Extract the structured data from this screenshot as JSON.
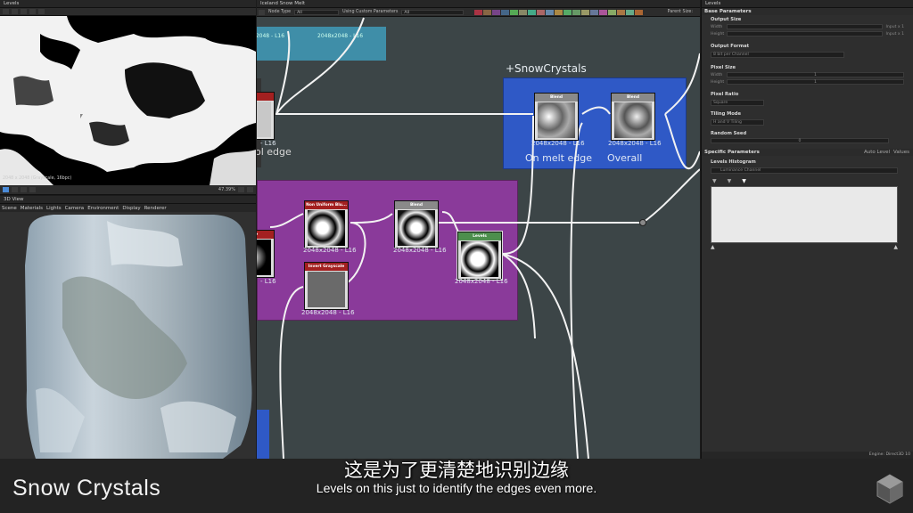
{
  "colors": {
    "accent": "#4b8bd8",
    "blue_frame": "#2d56c0",
    "purple_frame": "#8a3a9a",
    "teal_frame": "#4a8fa8",
    "red_header": "#a32020",
    "green_header": "#4d8f4d",
    "grey_header": "#8a8a8a"
  },
  "top_left": {
    "title": "Levels",
    "status": "2048 x 2048 (Grayscale, 16bpc)",
    "zoom": "47.39%"
  },
  "view3d": {
    "title": "3D View",
    "menu": [
      "Scene",
      "Materials",
      "Lights",
      "Camera",
      "Environment",
      "Display",
      "Renderer"
    ]
  },
  "graph": {
    "title": "Iceland Snow Melt",
    "node_type_label": "Node Type",
    "node_type_value": "All",
    "params_label": "Using Custom Parameters",
    "params_value": "All",
    "parent_size": "Parent Size:",
    "frames": {
      "snow_crystals": "+SnowCrystals",
      "on_melt_edge": "On melt edge",
      "overall": "Overall",
      "pool_edge": "ol edge",
      "top_res": "2048x2048 - L16"
    },
    "nodes": {
      "blend1": {
        "title": "Blend",
        "res": "2048x2048 - L16"
      },
      "blend2": {
        "title": "Blend",
        "res": "2048x2048 - L16"
      },
      "left_partial": {
        "title": "",
        "res": "- L16"
      },
      "non_uniform": {
        "title": "Non Uniform Blu...",
        "res": "2048x2048 - L16"
      },
      "blend3": {
        "title": "Blend",
        "res": "2048x2048 - L16"
      },
      "levels": {
        "title": "Levels",
        "res": "2048x2048 - L16"
      },
      "invert": {
        "title": "Invert Grayscale",
        "res": "2048x2048 - L16"
      },
      "left_grayscale": {
        "title": "...ale",
        "res": "- L16"
      },
      "left_partial2": {
        "title": "",
        "res": "- L16"
      }
    }
  },
  "right_panel": {
    "title": "Levels",
    "base_parameters": "Base Parameters",
    "output_size": "Output Size",
    "width": "Width",
    "height": "Height",
    "input_x1": "Input x 1",
    "input_x1b": "Input x 1",
    "output_format": "Output Format",
    "output_format_value": "8 bit per Channel",
    "pixel_size": "Pixel Size",
    "px_width": "Width",
    "px_height": "Height",
    "px_w_val": "1",
    "px_h_val": "1",
    "pixel_ratio": "Pixel Ratio",
    "pixel_ratio_value": "Square",
    "tiling_mode": "Tiling Mode",
    "tiling_mode_value": "H and V Tiling",
    "random_seed": "Random Seed",
    "random_seed_value": "0",
    "specific_parameters": "Specific Parameters",
    "auto_level": "Auto Level",
    "values": "Values",
    "levels_histogram": "Levels Histogram",
    "channel": "Luminance Channel",
    "engine": "Engine: Direct3D 10"
  },
  "subtitle": {
    "cn": "这是为了更清楚地识别边缘",
    "en": "Levels on this just to identify the edges even more."
  },
  "lower_title": "Snow Crystals"
}
